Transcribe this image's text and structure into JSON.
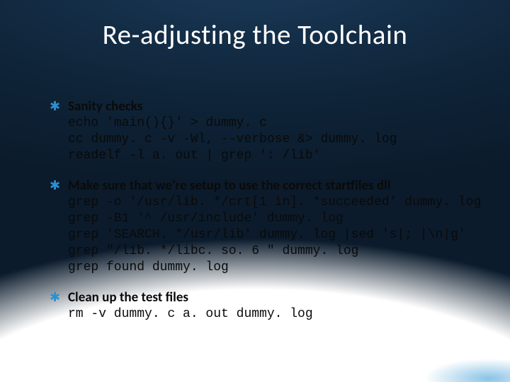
{
  "title": "Re-adjusting the Toolchain",
  "items": [
    {
      "heading": "Sanity checks",
      "code": "echo 'main(){}' > dummy. c\ncc dummy. c -v -Wl, --verbose &> dummy. log\nreadelf -l a. out | grep ': /lib'"
    },
    {
      "heading": "Make sure that we're setup to use the correct startfiles dll",
      "code": "grep -o '/usr/lib. */crt[1 in]. *succeeded' dummy. log\ngrep -B1 '^ /usr/include' dummy. log\ngrep 'SEARCH. */usr/lib' dummy. log |sed 's|; |\\n|g'\ngrep \"/lib. */libc. so. 6 \" dummy. log\ngrep found dummy. log"
    },
    {
      "heading": "Clean up the test files",
      "code": "rm -v dummy. c a. out dummy. log"
    }
  ]
}
